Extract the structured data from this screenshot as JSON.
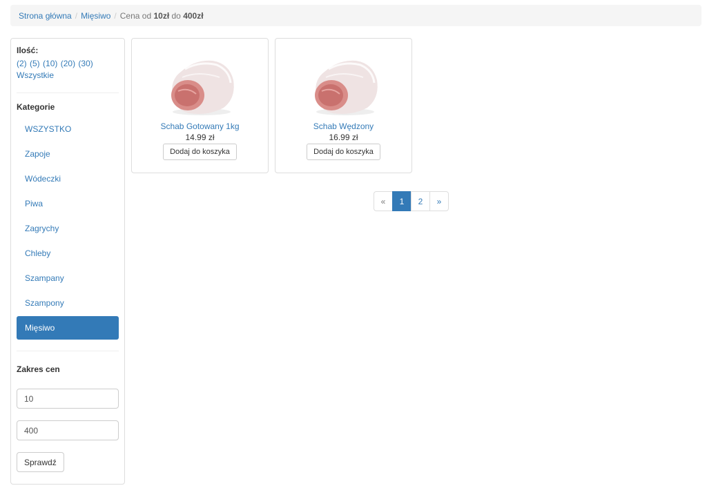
{
  "breadcrumb": {
    "home": "Strona główna",
    "category": "Mięsiwo",
    "filter_prefix": "Cena od",
    "price_from": "10zł",
    "filter_mid": "do",
    "price_to": "400zł"
  },
  "sidebar": {
    "qty_title": "Ilość:",
    "qty_options": [
      "(2)",
      "(5)",
      "(10)",
      "(20)",
      "(30)"
    ],
    "qty_all": "Wszystkie",
    "categories_title": "Kategorie",
    "categories": [
      {
        "label": "WSZYSTKO",
        "active": false
      },
      {
        "label": "Zapoje",
        "active": false
      },
      {
        "label": "Wódeczki",
        "active": false
      },
      {
        "label": "Piwa",
        "active": false
      },
      {
        "label": "Zagrychy",
        "active": false
      },
      {
        "label": "Chleby",
        "active": false
      },
      {
        "label": "Szampany",
        "active": false
      },
      {
        "label": "Szampony",
        "active": false
      },
      {
        "label": "Mięsiwo",
        "active": true
      }
    ],
    "range_title": "Zakres cen",
    "price_min": "10",
    "price_max": "400",
    "check_label": "Sprawdź"
  },
  "products": [
    {
      "name": "Schab Gotowany 1kg",
      "price": "14.99 zł",
      "add_label": "Dodaj do koszyka",
      "image": "pork-loin-image"
    },
    {
      "name": "Schab Wędzony",
      "price": "16.99 zł",
      "add_label": "Dodaj do koszyka",
      "image": "pork-loin-image"
    }
  ],
  "pagination": {
    "prev": "«",
    "pages": [
      "1",
      "2"
    ],
    "active_page": "1",
    "next": "»"
  },
  "colors": {
    "accent": "#337ab7",
    "breadcrumb_bg": "#f5f5f5",
    "border": "#dddddd"
  }
}
